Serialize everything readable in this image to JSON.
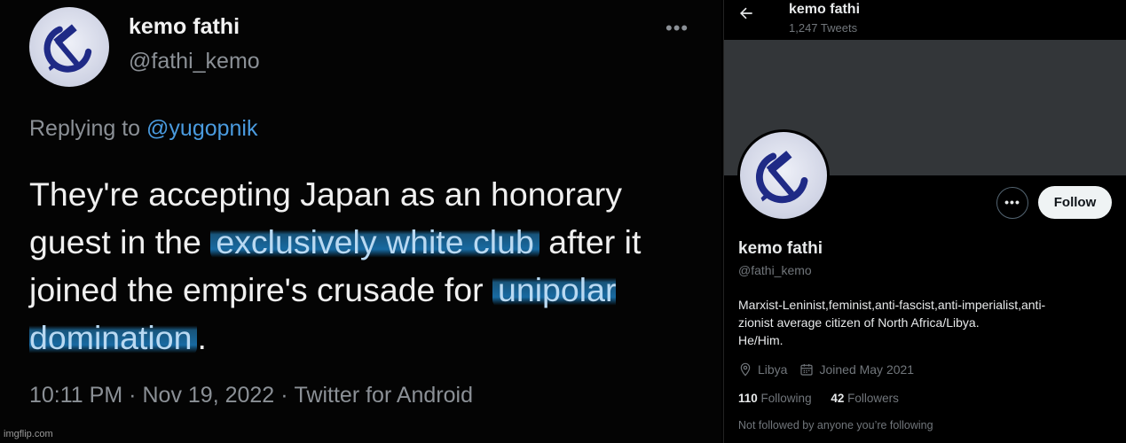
{
  "tweet": {
    "display_name": "kemo fathi",
    "handle": "@fathi_kemo",
    "more_icon": "more-horizontal-icon",
    "replying_to_prefix": "Replying to",
    "replying_to_mention": "@yugopnik",
    "body": {
      "part1": "They're accepting Japan as an honorary guest in the ",
      "hl1": "exclusively white club",
      "part2": " after it joined the empire's crusade for ",
      "hl2": "unipolar domination",
      "part3": "."
    },
    "time": "10:11 PM",
    "date": "Nov 19, 2022",
    "source": "Twitter for Android",
    "separator": "·"
  },
  "watermark": "imgflip.com",
  "profile": {
    "header": {
      "back_icon": "arrow-left-icon",
      "name": "kemo fathi",
      "tweet_count": "1,247 Tweets"
    },
    "more_button_icon": "more-horizontal-icon",
    "follow_label": "Follow",
    "name": "kemo fathi",
    "handle": "@fathi_kemo",
    "bio_lines": [
      "Marxist-Leninist,feminist,anti-fascist,anti-imperialist,anti-",
      "zionist average citizen of North Africa/Libya.",
      "He/Him."
    ],
    "location": "Libya",
    "joined": "Joined May 2021",
    "following_count": "110",
    "following_label": "Following",
    "followers_count": "42",
    "followers_label": "Followers",
    "not_followed_text": "Not followed by anyone you’re following"
  },
  "colors": {
    "link_blue": "#4a9bdf",
    "highlight_blue": "#1e8cd7",
    "avatar_symbol": "#1f2a86",
    "banner_gray": "#333639"
  }
}
